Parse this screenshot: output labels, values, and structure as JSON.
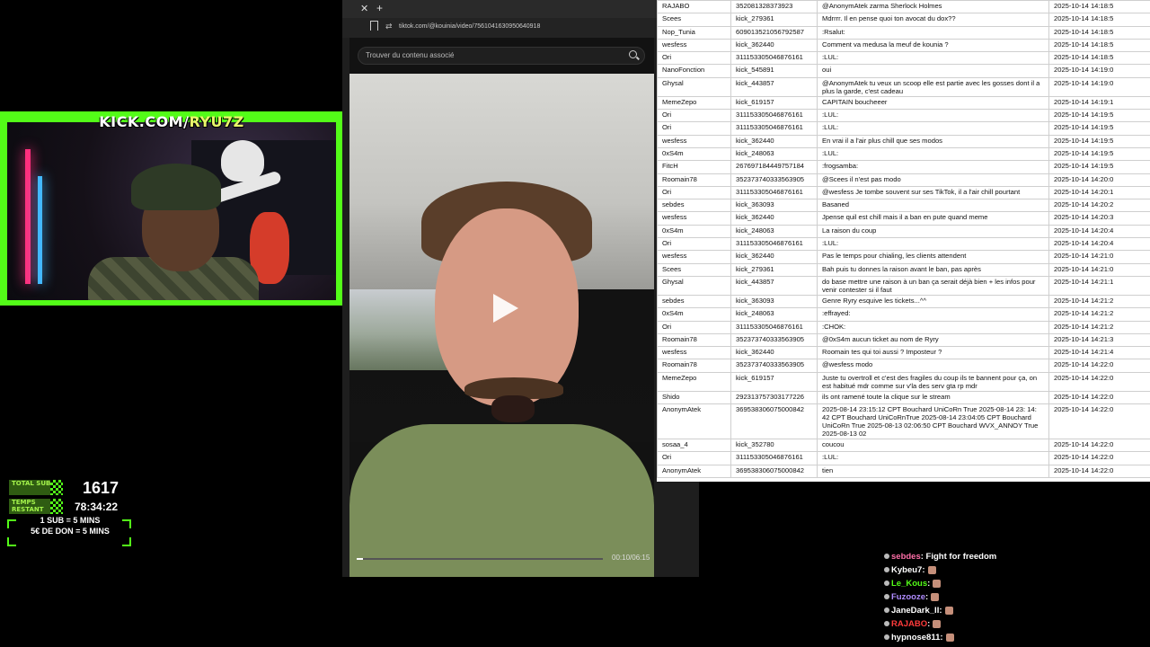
{
  "overlay": {
    "kick_prefix": "KICK.COM/",
    "kick_user": "RYU7Z",
    "total_label": "TOTAL SUBS",
    "total_value": "1617",
    "temps_label": "TEMPS RESTANT",
    "temps_value": "78:34:22",
    "rule_1": "1 SUB = 5 MINS",
    "rule_2": "5€ DE DON = 5 MINS",
    "accent": "#53fc18"
  },
  "browser": {
    "url": "tiktok.com/@kouinia/video/7561041630950640918",
    "search_placeholder": "Trouver du contenu associé",
    "video_time": "00:10/06:15",
    "progress": 0.027
  },
  "log": {
    "rows": [
      [
        "RAJABO",
        "352081328373923",
        "@AnonymAtek zarma Sherlock Holmes",
        "2025-10-14 14:18:5"
      ],
      [
        "Scees",
        "kick_279361",
        "Mdrrrr. Il en pense quoi ton avocat du dox??",
        "2025-10-14 14:18:5"
      ],
      [
        "Nop_Tunia",
        "609013521056792587",
        ":Rsalut:",
        "2025-10-14 14:18:5"
      ],
      [
        "wesfess",
        "kick_362440",
        "Comment va medusa la meuf de kounia ?",
        "2025-10-14 14:18:5"
      ],
      [
        "Ori",
        "311153305046876161",
        ":LUL:",
        "2025-10-14 14:18:5"
      ],
      [
        "NanoFonction",
        "kick_545891",
        "oui",
        "2025-10-14 14:19:0"
      ],
      [
        "Ghysal",
        "kick_443857",
        "@AnonymAtek tu veux un scoop elle est partie avec les gosses dont il a plus la garde, c'est cadeau",
        "2025-10-14 14:19:0"
      ],
      [
        "MemeZepo",
        "kick_619157",
        "CAPITAIN boucheeer",
        "2025-10-14 14:19:1"
      ],
      [
        "Ori",
        "311153305046876161",
        ":LUL:",
        "2025-10-14 14:19:5"
      ],
      [
        "Ori",
        "311153305046876161",
        ":LUL:",
        "2025-10-14 14:19:5"
      ],
      [
        "wesfess",
        "kick_362440",
        "En vrai il a l'air plus chill que ses modos",
        "2025-10-14 14:19:5"
      ],
      [
        "0xS4m",
        "kick_248063",
        ":LUL:",
        "2025-10-14 14:19:5"
      ],
      [
        "FitcH",
        "267697184449757184",
        ":frogsamba:",
        "2025-10-14 14:19:5"
      ],
      [
        "Roomain78",
        "352373740333563905",
        "@Scees il n'est pas modo",
        "2025-10-14 14:20:0"
      ],
      [
        "Ori",
        "311153305046876161",
        "@wesfess Je tombe souvent sur ses TikTok, il a l'air chill pourtant",
        "2025-10-14 14:20:1"
      ],
      [
        "sebdes",
        "kick_363093",
        "Basaned",
        "2025-10-14 14:20:2"
      ],
      [
        "wesfess",
        "kick_362440",
        "Jpense quil est chill mais il a ban en pute quand meme",
        "2025-10-14 14:20:3"
      ],
      [
        "0xS4m",
        "kick_248063",
        "La raison du coup",
        "2025-10-14 14:20:4"
      ],
      [
        "Ori",
        "311153305046876161",
        ":LUL:",
        "2025-10-14 14:20:4"
      ],
      [
        "wesfess",
        "kick_362440",
        "Pas le temps pour chialing, les clients attendent",
        "2025-10-14 14:21:0"
      ],
      [
        "Scees",
        "kick_279361",
        "Bah puis tu donnes la raison avant le ban, pas après",
        "2025-10-14 14:21:0"
      ],
      [
        "Ghysal",
        "kick_443857",
        "do base mettre une raison à un ban ça serait déjà bien + les infos pour venir contester si il faut",
        "2025-10-14 14:21:1"
      ],
      [
        "sebdes",
        "kick_363093",
        "Genre Ryry esquive les tickets...^^",
        "2025-10-14 14:21:2"
      ],
      [
        "0xS4m",
        "kick_248063",
        ":effrayed:",
        "2025-10-14 14:21:2"
      ],
      [
        "Ori",
        "311153305046876161",
        ":CHOK:",
        "2025-10-14 14:21:2"
      ],
      [
        "Roomain78",
        "352373740333563905",
        "@0xS4m aucun ticket au nom de Ryry",
        "2025-10-14 14:21:3"
      ],
      [
        "wesfess",
        "kick_362440",
        "Roomain tes qui toi aussi ? Imposteur ?",
        "2025-10-14 14:21:4"
      ],
      [
        "Roomain78",
        "352373740333563905",
        "@wesfess modo",
        "2025-10-14 14:22:0"
      ],
      [
        "MemeZepo",
        "kick_619157",
        "Juste tu overtroll et c'est des fragiles du coup ils te bannent pour ça, on est habitué mdr comme sur v'la des serv gta rp mdr",
        "2025-10-14 14:22:0"
      ],
      [
        "Shido",
        "292313757303177226",
        "ils ont ramené toute la clique sur le stream",
        "2025-10-14 14:22:0"
      ],
      [
        "AnonymAtek",
        "369538306075000842",
        "2025-08-14 23:15:12 CPT Bouchard UniCoRn True 2025-08-14 23: 14: 42 CPT Bouchard UniCoRnTrue 2025-08-14 23:04:05 CPT Bouchard UniCoRn True 2025-08-13 02:06:50 CPT Bouchard WVX_ANNOY True 2025-08-13 02",
        "2025-10-14 14:22:0"
      ],
      [
        "sosaa_4",
        "kick_352780",
        "coucou",
        "2025-10-14 14:22:0"
      ],
      [
        "Ori",
        "311153305046876161",
        ":LUL:",
        "2025-10-14 14:22:0"
      ],
      [
        "AnonymAtek",
        "369538306075000842",
        "tien",
        "2025-10-14 14:22:0"
      ]
    ]
  },
  "chat": [
    {
      "user": "sebdes",
      "color": "#ff6fa8",
      "text": "Fight for freedom"
    },
    {
      "user": "Kybeu7",
      "color": "#ffffff",
      "text": ""
    },
    {
      "user": "Le_Kous",
      "color": "#53fc18",
      "text": ""
    },
    {
      "user": "Fuzooze",
      "color": "#b08cff",
      "text": ""
    },
    {
      "user": "JaneDark_II",
      "color": "#ffffff",
      "text": ""
    },
    {
      "user": "RAJABO",
      "color": "#ff3b3b",
      "text": ""
    },
    {
      "user": "hypnose811",
      "color": "#ffffff",
      "text": ""
    }
  ]
}
